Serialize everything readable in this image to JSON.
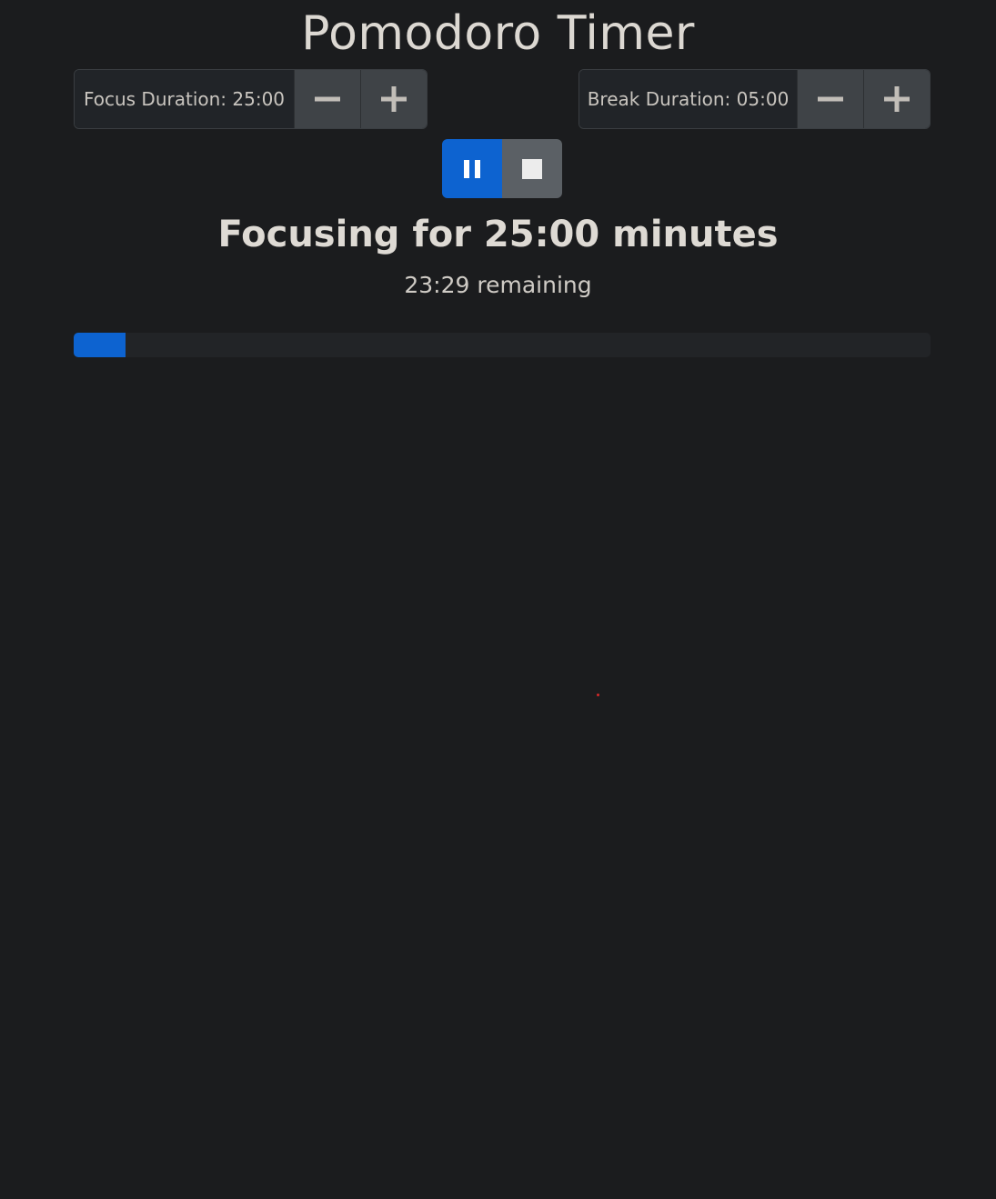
{
  "header": {
    "title": "Pomodoro Timer"
  },
  "focus": {
    "label": "Focus Duration: 25:00",
    "decrement_icon": "minus-icon",
    "increment_icon": "plus-icon"
  },
  "break": {
    "label": "Break Duration: 05:00",
    "decrement_icon": "minus-icon",
    "increment_icon": "plus-icon"
  },
  "controls": {
    "pause_icon": "pause-icon",
    "stop_icon": "stop-icon"
  },
  "status": {
    "heading": "Focusing for 25:00 minutes",
    "remaining": "23:29 remaining"
  },
  "progress": {
    "fraction": 0.06
  },
  "colors": {
    "accent": "#0d63d0",
    "background": "#1b1c1e",
    "button": "#3f4347",
    "stop_button": "#5b6065"
  }
}
